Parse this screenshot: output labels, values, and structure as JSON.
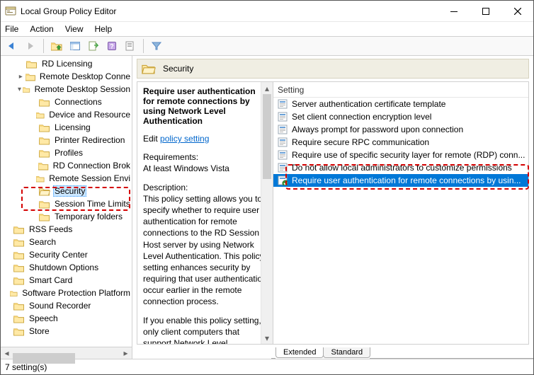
{
  "window": {
    "title": "Local Group Policy Editor"
  },
  "menus": [
    "File",
    "Action",
    "View",
    "Help"
  ],
  "tree": {
    "items": [
      {
        "indent": 1,
        "twisty": "",
        "label": "RD Licensing"
      },
      {
        "indent": 1,
        "twisty": "▸",
        "label": "Remote Desktop Conne"
      },
      {
        "indent": 1,
        "twisty": "▾",
        "label": "Remote Desktop Session"
      },
      {
        "indent": 2,
        "twisty": "",
        "label": "Connections"
      },
      {
        "indent": 2,
        "twisty": "",
        "label": "Device and Resource"
      },
      {
        "indent": 2,
        "twisty": "",
        "label": "Licensing"
      },
      {
        "indent": 2,
        "twisty": "",
        "label": "Printer Redirection"
      },
      {
        "indent": 2,
        "twisty": "",
        "label": "Profiles"
      },
      {
        "indent": 2,
        "twisty": "",
        "label": "RD Connection Brok"
      },
      {
        "indent": 2,
        "twisty": "",
        "label": "Remote Session Envi"
      },
      {
        "indent": 2,
        "twisty": "",
        "label": "Security",
        "selected": true
      },
      {
        "indent": 2,
        "twisty": "",
        "label": "Session Time Limits"
      },
      {
        "indent": 2,
        "twisty": "",
        "label": "Temporary folders"
      },
      {
        "indent": 0,
        "twisty": "",
        "label": "RSS Feeds"
      },
      {
        "indent": 0,
        "twisty": "",
        "label": "Search"
      },
      {
        "indent": 0,
        "twisty": "",
        "label": "Security Center"
      },
      {
        "indent": 0,
        "twisty": "",
        "label": "Shutdown Options"
      },
      {
        "indent": 0,
        "twisty": "",
        "label": "Smart Card"
      },
      {
        "indent": 0,
        "twisty": "",
        "label": "Software Protection Platform"
      },
      {
        "indent": 0,
        "twisty": "",
        "label": "Sound Recorder"
      },
      {
        "indent": 0,
        "twisty": "",
        "label": "Speech"
      },
      {
        "indent": 0,
        "twisty": "",
        "label": "Store"
      }
    ]
  },
  "header": {
    "category": "Security"
  },
  "description": {
    "title": "Require user authentication for remote connections by using Network Level Authentication",
    "edit_prefix": "Edit ",
    "edit_link": "policy setting ",
    "req_label": "Requirements:",
    "req_value": "At least Windows Vista",
    "desc_label": "Description:",
    "desc_body": "This policy setting allows you to specify whether to require user authentication for remote connections to the RD Session Host server by using Network Level Authentication. This policy setting enhances security by requiring that user authentication occur earlier in the remote connection process.",
    "desc_body2": "If you enable this policy setting, only client computers that support Network Level"
  },
  "list": {
    "header": "Setting",
    "items": [
      "Server authentication certificate template",
      "Set client connection encryption level",
      "Always prompt for password upon connection",
      "Require secure RPC communication",
      "Require use of specific security layer for remote (RDP) conn...",
      "Do not allow local administrators to customize permissions",
      "Require user authentication for remote connections by usin..."
    ],
    "selected_index": 6
  },
  "tabs": {
    "extended": "Extended",
    "standard": "Standard"
  },
  "status": "7 setting(s)"
}
